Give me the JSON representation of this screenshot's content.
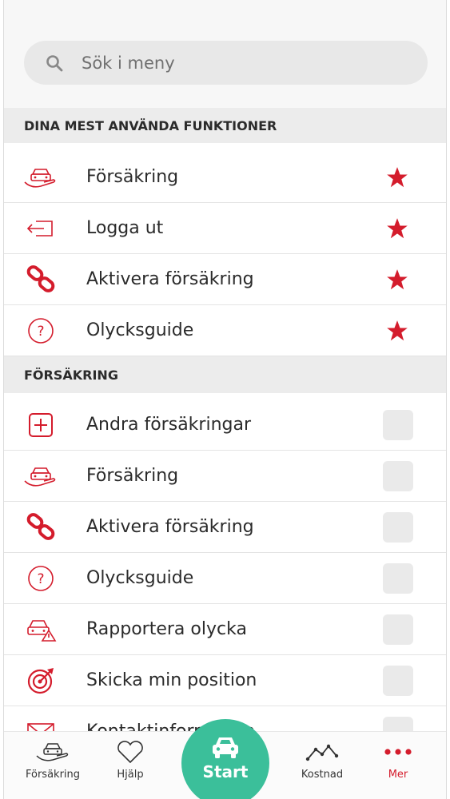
{
  "search": {
    "placeholder": "Sök i meny"
  },
  "sections": [
    {
      "title": "DINA MEST ANVÄNDA FUNKTIONER",
      "items": [
        {
          "label": "Försäkring",
          "icon": "hand-car-icon",
          "favorite": true
        },
        {
          "label": "Logga ut",
          "icon": "logout-icon",
          "favorite": true
        },
        {
          "label": "Aktivera försäkring",
          "icon": "link-icon",
          "favorite": true
        },
        {
          "label": "Olycksguide",
          "icon": "question-icon",
          "favorite": true
        }
      ]
    },
    {
      "title": "FÖRSÄKRING",
      "items": [
        {
          "label": "Andra försäkringar",
          "icon": "plus-box-icon",
          "favorite": false
        },
        {
          "label": "Försäkring",
          "icon": "hand-car-icon",
          "favorite": false
        },
        {
          "label": "Aktivera försäkring",
          "icon": "link-icon",
          "favorite": false
        },
        {
          "label": "Olycksguide",
          "icon": "question-icon",
          "favorite": false
        },
        {
          "label": "Rapportera olycka",
          "icon": "car-warning-icon",
          "favorite": false
        },
        {
          "label": "Skicka min position",
          "icon": "target-icon",
          "favorite": false
        },
        {
          "label": "Kontaktinformation",
          "icon": "mail-icon",
          "favorite": false
        }
      ]
    }
  ],
  "tabbar": {
    "tabs": [
      {
        "label": "Försäkring",
        "icon": "hand-car-icon"
      },
      {
        "label": "Hjälp",
        "icon": "heart-icon"
      },
      {
        "label": "Kostnad",
        "icon": "line-chart-icon"
      },
      {
        "label": "Mer",
        "icon": "more-dots-icon",
        "active": true
      }
    ],
    "start_label": "Start"
  },
  "colors": {
    "accent": "#d41c2c",
    "start": "#3bbf9a"
  }
}
